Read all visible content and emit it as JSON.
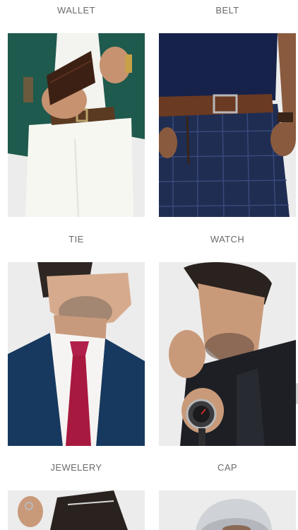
{
  "categories": [
    {
      "label": "WALLET",
      "image_icon": "wallet-photo"
    },
    {
      "label": "BELT",
      "image_icon": "belt-photo"
    },
    {
      "label": "TIE",
      "image_icon": "tie-photo"
    },
    {
      "label": "WATCH",
      "image_icon": "watch-photo"
    },
    {
      "label": "JEWELERY",
      "image_icon": "jewelery-photo"
    },
    {
      "label": "CAP",
      "image_icon": "cap-photo"
    }
  ],
  "colors": {
    "label_text": "#6b6b6b",
    "image_bg": "#e8e8e8"
  }
}
